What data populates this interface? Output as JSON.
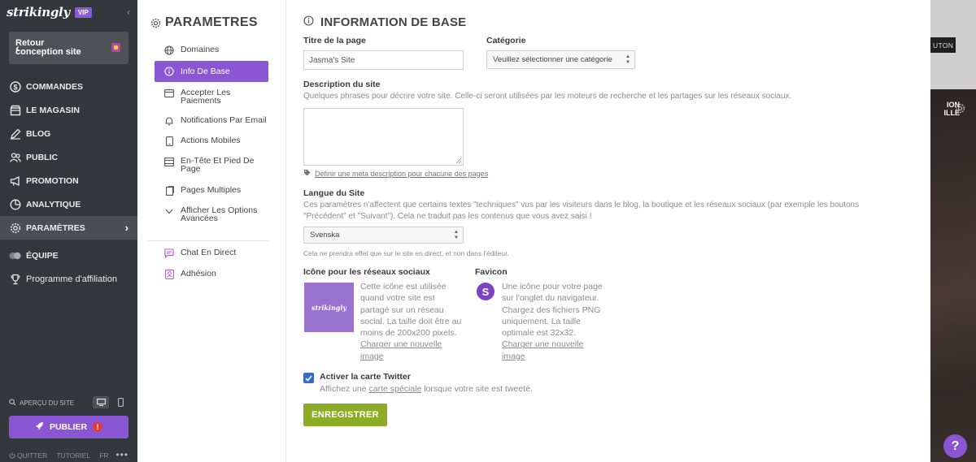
{
  "app": {
    "brand": "strikingly",
    "badge": "VIP",
    "back_label": "Retour conception site"
  },
  "nav": {
    "items": [
      {
        "label": "COMMANDES",
        "icon": "dollar-icon"
      },
      {
        "label": "LE MAGASIN",
        "icon": "store-icon"
      },
      {
        "label": "BLOG",
        "icon": "pen-icon"
      },
      {
        "label": "PUBLIC",
        "icon": "users-icon"
      },
      {
        "label": "PROMOTION",
        "icon": "megaphone-icon"
      },
      {
        "label": "ANALYTIQUE",
        "icon": "chart-icon"
      },
      {
        "label": "PARAMÈTRES",
        "icon": "gear-icon"
      },
      {
        "label": "ÉQUIPE",
        "icon": "team-icon"
      },
      {
        "label": "Programme d'affiliation",
        "icon": "trophy-icon"
      }
    ]
  },
  "footer": {
    "preview_label": "APERÇU DU SITE",
    "publish_label": "PUBLIER",
    "publish_alert": "!",
    "quit": "QUITTER",
    "tutorial": "TUTORIEL",
    "lang": "FR",
    "more": "•••"
  },
  "settings_menu": {
    "title": "PARAMETRES",
    "items": [
      {
        "label": "Domaines",
        "icon": "globe-icon"
      },
      {
        "label": "Info De Base",
        "icon": "info-icon"
      },
      {
        "label": "Accepter Les Paiements",
        "icon": "card-icon"
      },
      {
        "label": "Notifications Par Email",
        "icon": "bell-icon"
      },
      {
        "label": "Actions Mobiles",
        "icon": "mobile-icon"
      },
      {
        "label": "En-Tête Et Pied De Page",
        "icon": "layout-icon"
      },
      {
        "label": "Pages Multiples",
        "icon": "pages-icon"
      },
      {
        "label": "Afficher Les Options Avancées",
        "icon": "chevron-down-icon"
      },
      {
        "label": "Chat En Direct",
        "icon": "chat-icon"
      },
      {
        "label": "Adhésion",
        "icon": "member-icon"
      }
    ]
  },
  "form": {
    "title": "INFORMATION DE BASE",
    "page_title_label": "Titre de la page",
    "page_title_value": "Jasma's Site",
    "category_label": "Catégorie",
    "category_value": "Veuillez sélectionner une catégorie",
    "description_label": "Description du site",
    "description_help": "Quelques phrases pour décrire votre site. Celle-ci seront utilisées par les moteurs de recherche et les partages sur les réseaux sociaux.",
    "meta_link": "Définir une meta description pour chacune des pages",
    "language_label": "Langue du Site",
    "language_help": "Ces paramètres n'affectent que certains textes \"techniques\" vus par les visiteurs dans le blog, la boutique et les réseaux sociaux (par exemple les boutons \"Précédent\" et \"Suivant\"). Cela ne traduit pas les contenus que vous avez saisi !",
    "language_value": "Svenska",
    "language_note": "Cela ne prendra effet que sur le site en direct, et non dans l'éditeur.",
    "social_icon_label": "Icône pour les réseaux sociaux",
    "social_thumb_text": "strikingly",
    "social_icon_desc": "Cette icône est utilisée quand votre site est partagé sur un réseau social. La taille doit être au moins de 200x200 pixels.",
    "social_upload": "Charger une nouvelle image",
    "favicon_label": "Favicon",
    "favicon_letter": "S",
    "favicon_desc": "Une icône pour votre page sur l'onglet du navigateur. Chargez des fichiers PNG uniquement. La taille optimale est 32x32.",
    "favicon_upload": "Charger une nouvelle image",
    "twitter_label": "Activer la carte Twitter",
    "twitter_desc_pre": "Affichez une ",
    "twitter_desc_link": "carte spéciale",
    "twitter_desc_post": " lorsque votre site est tweeté.",
    "twitter_checked": true,
    "save_label": "ENREGISTRER"
  },
  "preview": {
    "button_text": "UTON",
    "overlay_text": "ION ILLE"
  },
  "help": {
    "label": "?"
  }
}
